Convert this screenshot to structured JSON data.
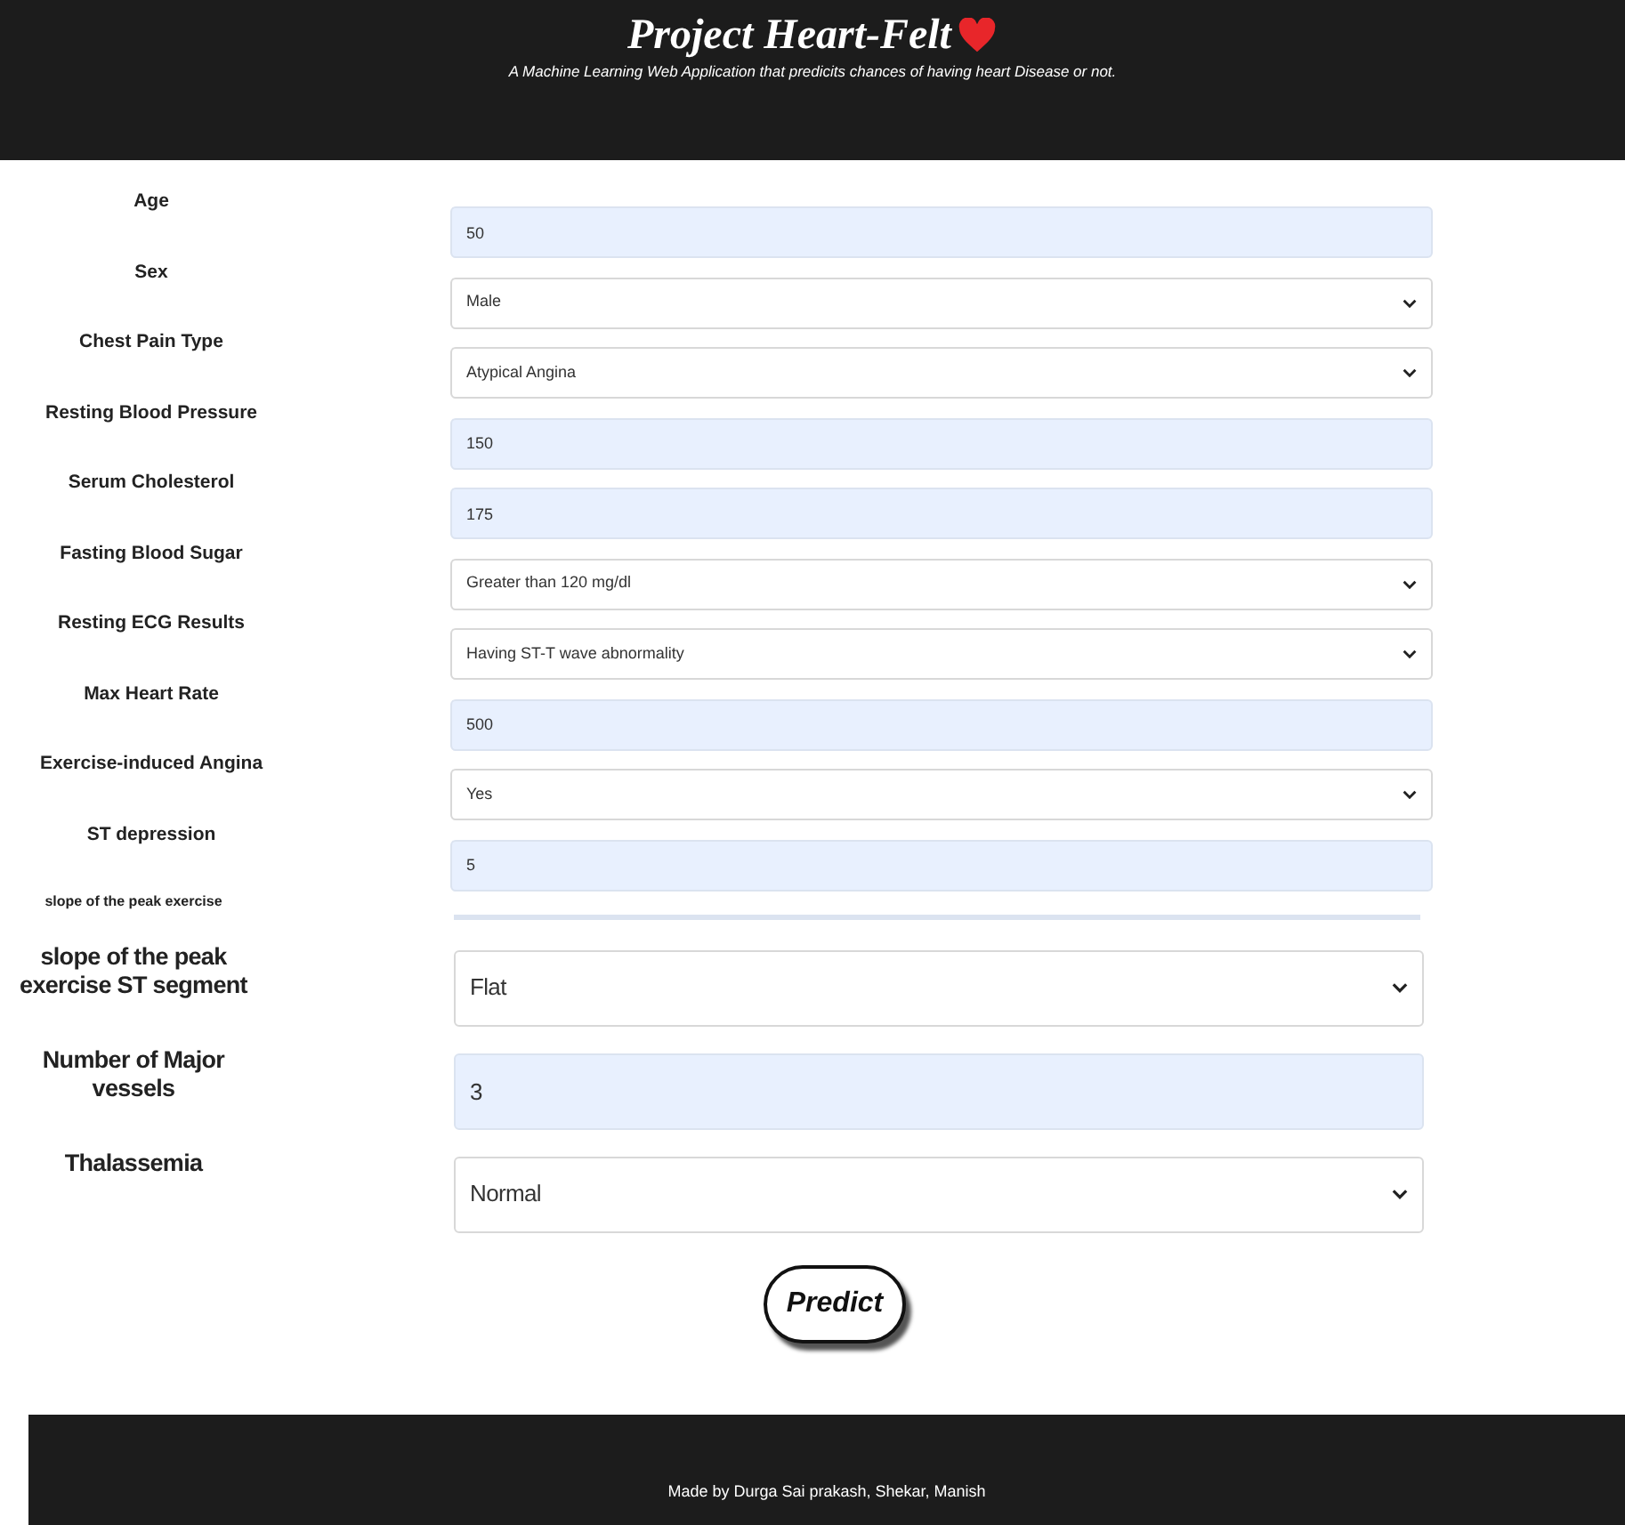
{
  "header": {
    "title": "Project Heart-Felt",
    "subtitle": "A Machine Learning Web Application that predicits chances of having heart Disease or not."
  },
  "form": [
    {
      "label": "Age",
      "kind": "input",
      "value": "50"
    },
    {
      "label": "Sex",
      "kind": "select",
      "value": "Male"
    },
    {
      "label": "Chest Pain Type",
      "kind": "select",
      "value": "Atypical Angina"
    },
    {
      "label": "Resting Blood Pressure",
      "kind": "input",
      "value": "150"
    },
    {
      "label": "Serum Cholesterol",
      "kind": "input",
      "value": "175"
    },
    {
      "label": "Fasting Blood Sugar",
      "kind": "select",
      "value": "Greater than 120 mg/dl"
    },
    {
      "label": "Resting ECG Results",
      "kind": "select",
      "value": "Having ST-T wave abnormality"
    },
    {
      "label": "Max Heart Rate",
      "kind": "input",
      "value": "500"
    },
    {
      "label": "Exercise-induced Angina",
      "kind": "select",
      "value": "Yes"
    },
    {
      "label": "ST depression",
      "kind": "input",
      "value": "5"
    }
  ],
  "cut_label": "slope of the peak exercise",
  "form_continued": [
    {
      "label": "slope of the peak exercise ST segment",
      "kind": "select",
      "value": "Flat"
    },
    {
      "label": "Number of Major vessels",
      "kind": "input",
      "value": "3"
    },
    {
      "label": "Thalassemia",
      "kind": "select",
      "value": "Normal"
    }
  ],
  "predict_button": "Predict",
  "footer": "Made by Durga Sai prakash, Shekar, Manish"
}
